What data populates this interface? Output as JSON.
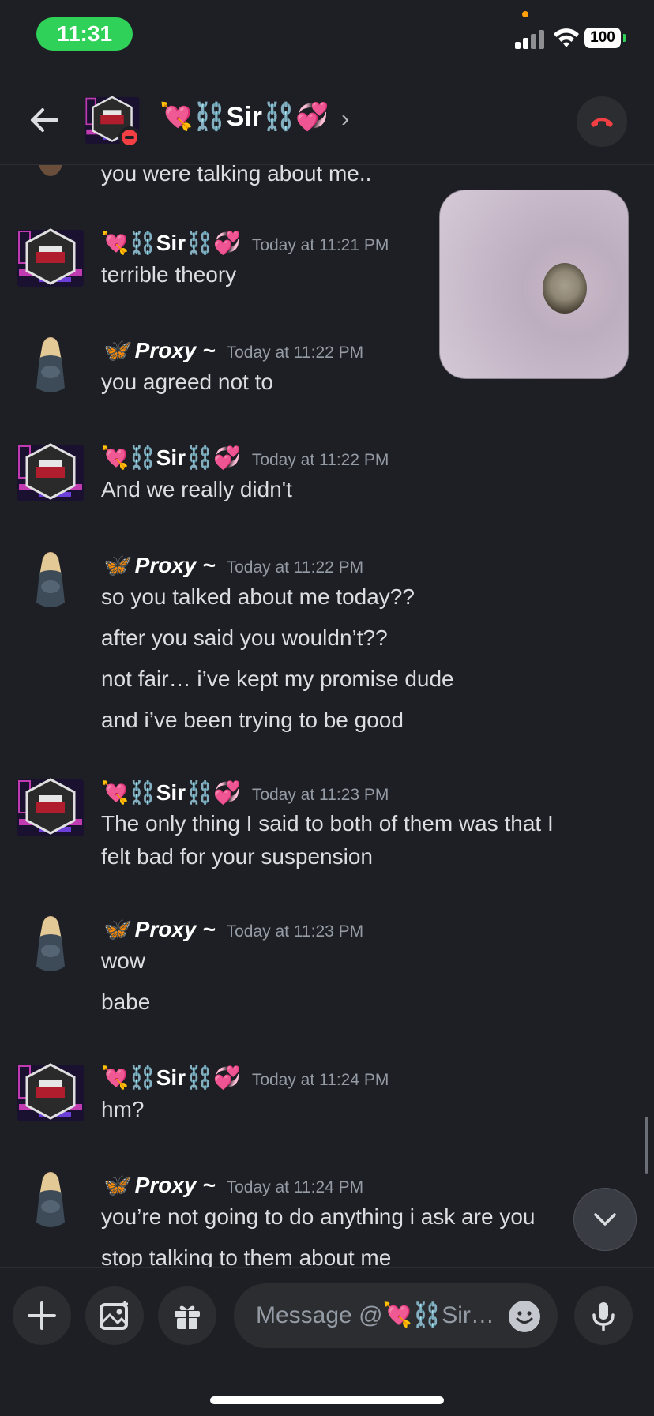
{
  "status_bar": {
    "time": "11:31",
    "battery": "100"
  },
  "header": {
    "name": "💘⛓️Sir⛓️💞",
    "chevron": "›"
  },
  "messages": [
    {
      "lines": [
        "you were talking about me.."
      ]
    },
    {
      "author": "💘⛓️Sir⛓️💞",
      "timestamp": "Today at 11:21 PM",
      "lines": [
        "terrible theory"
      ]
    },
    {
      "author": "🦋 Proxy ~",
      "timestamp": "Today at 11:22 PM",
      "lines": [
        "you agreed not to"
      ]
    },
    {
      "author": "💘⛓️Sir⛓️💞",
      "timestamp": "Today at 11:22 PM",
      "lines": [
        "And we really didn't"
      ]
    },
    {
      "author": "🦋 Proxy ~",
      "timestamp": "Today at 11:22 PM",
      "lines": [
        "so you talked about me today??",
        "after you said you wouldn’t??",
        "not fair… i’ve kept my promise dude",
        "and i’ve been trying to be good"
      ]
    },
    {
      "author": "💘⛓️Sir⛓️💞",
      "timestamp": "Today at 11:23 PM",
      "lines": [
        "The only thing I said to both of them was that I",
        "felt bad for your suspension"
      ]
    },
    {
      "author": "🦋 Proxy ~",
      "timestamp": "Today at 11:23 PM",
      "lines": [
        "wow",
        "babe"
      ]
    },
    {
      "author": "💘⛓️Sir⛓️💞",
      "timestamp": "Today at 11:24 PM",
      "lines": [
        "hm?"
      ]
    },
    {
      "author": "🦋 Proxy ~",
      "timestamp": "Today at 11:24 PM",
      "lines": [
        "you’re not going to do anything i ask are you",
        "stop talking to them about me"
      ]
    }
  ],
  "composer": {
    "placeholder": "Message @💘⛓️Sir…"
  },
  "colors": {
    "call_pill": "#30d158",
    "end_call": "#f23f43",
    "background": "#1e1f24"
  }
}
